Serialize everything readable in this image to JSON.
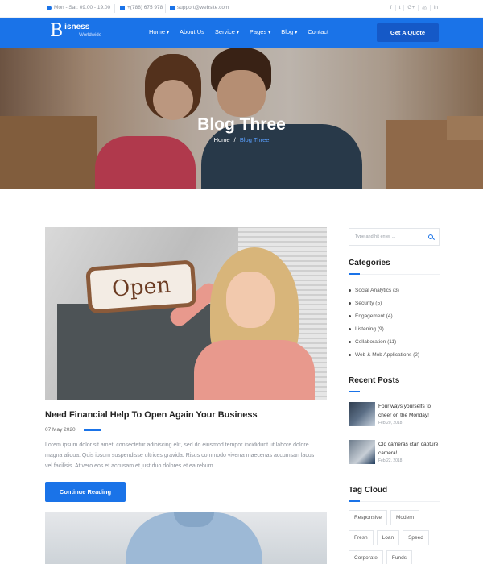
{
  "topbar": {
    "hours": "Mon - Sat: 09.00 - 19.00",
    "phone": "+(788) 675 978",
    "email": "support@website.com",
    "social": [
      "f",
      "t",
      "G+",
      "◎",
      "in"
    ]
  },
  "nav": {
    "logo_letter": "B",
    "logo_name": "isness",
    "logo_sub": "Worldwide",
    "menu": [
      {
        "label": "Home",
        "caret": true
      },
      {
        "label": "About Us",
        "caret": false
      },
      {
        "label": "Service",
        "caret": true
      },
      {
        "label": "Pages",
        "caret": true
      },
      {
        "label": "Blog",
        "caret": true
      },
      {
        "label": "Contact",
        "caret": false
      }
    ],
    "cta": "Get A Quote"
  },
  "hero": {
    "title": "Blog Three",
    "crumb_home": "Home",
    "crumb_sep": "/",
    "crumb_current": "Blog Three"
  },
  "post": {
    "sign_text": "Open",
    "title": "Need Financial Help To Open Again Your Business",
    "date": "07 May 2020",
    "excerpt": "Lorem ipsum dolor sit amet, consectetur adipiscing elit, sed do eiusmod tempor incididunt ut labore dolore magna aliqua. Quis ipsum suspendisse ultrices gravida. Risus commodo viverra maecenas accumsan lacus vel facilisis. At vero eos et accusam et just duo dolores et ea rebum.",
    "read_more": "Continue Reading"
  },
  "sidebar": {
    "search_placeholder": "Type and hit enter ...",
    "categories_title": "Categories",
    "categories": [
      "Social Analytics (3)",
      "Security (5)",
      "Engagement (4)",
      "Listening (9)",
      "Collaboration (11)",
      "Web & Mob Applications (2)"
    ],
    "recent_title": "Recent Posts",
    "recent": [
      {
        "title": "Four ways yourselfs to cheer on the Monday!",
        "date": "Feb 20, 2018"
      },
      {
        "title": "Old cameras ctan capture camera!",
        "date": "Feb 22, 2018"
      }
    ],
    "tags_title": "Tag Cloud",
    "tags": [
      "Responsive",
      "Modern",
      "Fresh",
      "Loan",
      "Speed",
      "Corporate",
      "Funds"
    ]
  },
  "colors": {
    "accent": "#1a73e8",
    "nav_bg": "#1a73e8",
    "cta_bg": "#1559c7"
  }
}
